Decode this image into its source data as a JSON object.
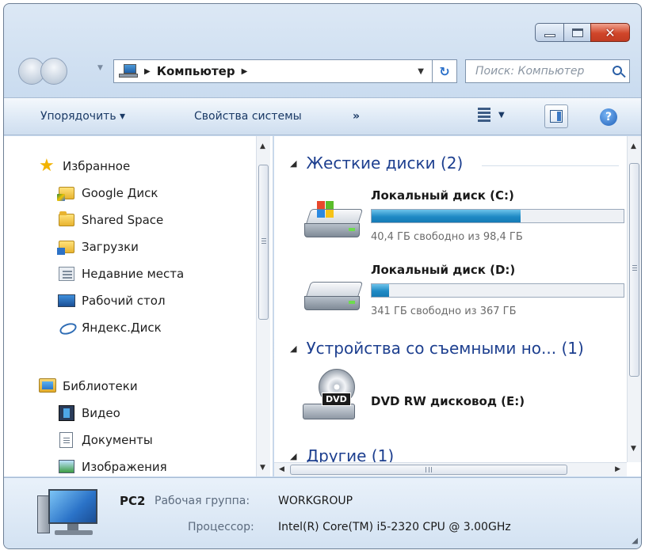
{
  "window": {
    "address_segment": "Компьютер",
    "search_placeholder": "Поиск: Компьютер",
    "close_glyph": "✕"
  },
  "toolbar": {
    "organize_label": "Упорядочить ▾",
    "system_properties_label": "Свойства системы",
    "more_label": "»"
  },
  "navigation": {
    "favorites": {
      "label": "Избранное",
      "items": [
        {
          "label": "Google Диск",
          "icon": "google-drive-folder-icon"
        },
        {
          "label": "Shared Space",
          "icon": "folder-icon"
        },
        {
          "label": "Загрузки",
          "icon": "downloads-folder-icon"
        },
        {
          "label": "Недавние места",
          "icon": "recent-places-icon"
        },
        {
          "label": "Рабочий стол",
          "icon": "desktop-icon"
        },
        {
          "label": "Яндекс.Диск",
          "icon": "yandex-disk-icon"
        }
      ]
    },
    "libraries": {
      "label": "Библиотеки",
      "items": [
        {
          "label": "Видео",
          "icon": "video-library-icon"
        },
        {
          "label": "Документы",
          "icon": "documents-library-icon"
        },
        {
          "label": "Изображения",
          "icon": "pictures-library-icon"
        }
      ]
    }
  },
  "content": {
    "groups": [
      {
        "title": "Жесткие диски (2)",
        "drives": [
          {
            "name": "Локальный диск (C:)",
            "free_text": "40,4 ГБ свободно из 98,4 ГБ",
            "used_fraction": 0.59
          },
          {
            "name": "Локальный диск (D:)",
            "free_text": "341 ГБ свободно из 367 ГБ",
            "used_fraction": 0.07
          }
        ]
      },
      {
        "title": "Устройства со съемными но... (1)",
        "devices": [
          {
            "name": "DVD RW дисковод (E:)",
            "icon_label": "DVD"
          }
        ]
      },
      {
        "title": "Другие (1)"
      }
    ]
  },
  "details": {
    "computer_name": "PC2",
    "workgroup_label": "Рабочая группа:",
    "workgroup_value": "WORKGROUP",
    "processor_label": "Процессор:",
    "processor_value": "Intel(R) Core(TM) i5-2320 CPU @ 3.00GHz"
  },
  "colors": {
    "accent": "#1d3f8f",
    "drive_bar": "#1f8ac5"
  }
}
